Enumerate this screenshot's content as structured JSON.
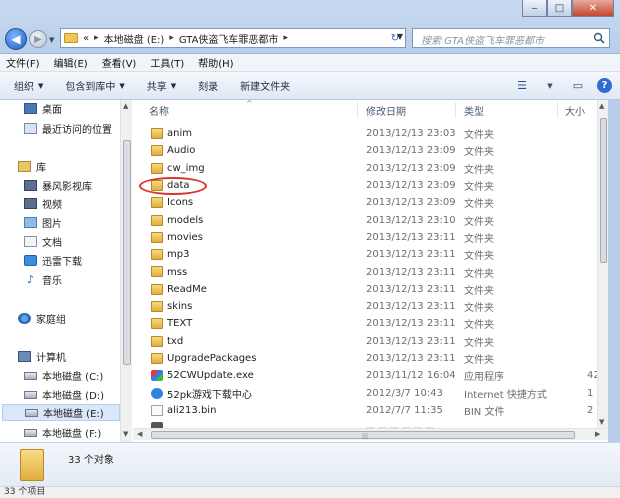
{
  "window": {
    "search_placeholder": "搜索 GTA侠盗飞车罪恶都市",
    "breadcrumb": [
      "«",
      "本地磁盘 (E:)",
      "GTA侠盗飞车罪恶都市"
    ]
  },
  "menu": [
    "文件(F)",
    "编辑(E)",
    "查看(V)",
    "工具(T)",
    "帮助(H)"
  ],
  "toolbar": {
    "organize": "组织",
    "include_library": "包含到库中",
    "share": "共享",
    "burn": "刻录",
    "new_folder": "新建文件夹"
  },
  "nav": {
    "desktop": "桌面",
    "recent": "最近访问的位置",
    "libraries": "库",
    "storm_video": "暴风影视库",
    "videos": "视频",
    "pictures": "图片",
    "documents": "文档",
    "xunlei": "迅雷下载",
    "music": "音乐",
    "homegroup": "家庭组",
    "computer": "计算机",
    "drive_c": "本地磁盘 (C:)",
    "drive_d": "本地磁盘 (D:)",
    "drive_e": "本地磁盘 (E:)",
    "drive_f": "本地磁盘 (F:)"
  },
  "columns": {
    "name": "名称",
    "date": "修改日期",
    "type": "类型",
    "size": "大小"
  },
  "files": [
    {
      "name": "anim",
      "date": "2013/12/13 23:03",
      "type": "文件夹",
      "size": "",
      "icon": "folder"
    },
    {
      "name": "Audio",
      "date": "2013/12/13 23:09",
      "type": "文件夹",
      "size": "",
      "icon": "folder"
    },
    {
      "name": "cw_img",
      "date": "2013/12/13 23:09",
      "type": "文件夹",
      "size": "",
      "icon": "folder"
    },
    {
      "name": "data",
      "date": "2013/12/13 23:09",
      "type": "文件夹",
      "size": "",
      "icon": "folder"
    },
    {
      "name": "Icons",
      "date": "2013/12/13 23:09",
      "type": "文件夹",
      "size": "",
      "icon": "folder"
    },
    {
      "name": "models",
      "date": "2013/12/13 23:10",
      "type": "文件夹",
      "size": "",
      "icon": "folder"
    },
    {
      "name": "movies",
      "date": "2013/12/13 23:11",
      "type": "文件夹",
      "size": "",
      "icon": "folder"
    },
    {
      "name": "mp3",
      "date": "2013/12/13 23:11",
      "type": "文件夹",
      "size": "",
      "icon": "folder"
    },
    {
      "name": "mss",
      "date": "2013/12/13 23:11",
      "type": "文件夹",
      "size": "",
      "icon": "folder"
    },
    {
      "name": "ReadMe",
      "date": "2013/12/13 23:11",
      "type": "文件夹",
      "size": "",
      "icon": "folder"
    },
    {
      "name": "skins",
      "date": "2013/12/13 23:11",
      "type": "文件夹",
      "size": "",
      "icon": "folder"
    },
    {
      "name": "TEXT",
      "date": "2013/12/13 23:11",
      "type": "文件夹",
      "size": "",
      "icon": "folder"
    },
    {
      "name": "txd",
      "date": "2013/12/13 23:11",
      "type": "文件夹",
      "size": "",
      "icon": "folder"
    },
    {
      "name": "UpgradePackages",
      "date": "2013/12/13 23:11",
      "type": "文件夹",
      "size": "",
      "icon": "folder"
    },
    {
      "name": "52CWUpdate.exe",
      "date": "2013/11/12 16:04",
      "type": "应用程序",
      "size": "42",
      "icon": "exe"
    },
    {
      "name": "52pk游戏下载中心",
      "date": "2012/3/7 10:43",
      "type": "Internet 快捷方式",
      "size": "1",
      "icon": "url"
    },
    {
      "name": "ali213.bin",
      "date": "2012/7/7 11:35",
      "type": "BIN 文件",
      "size": "2",
      "icon": "bin"
    }
  ],
  "details": {
    "count_text": "33 个对象"
  },
  "status": {
    "text": "33 个项目"
  },
  "colors": {
    "highlight_ring": "#d9362e",
    "folder": "#e2b03c",
    "chrome": "#b7cde9"
  }
}
